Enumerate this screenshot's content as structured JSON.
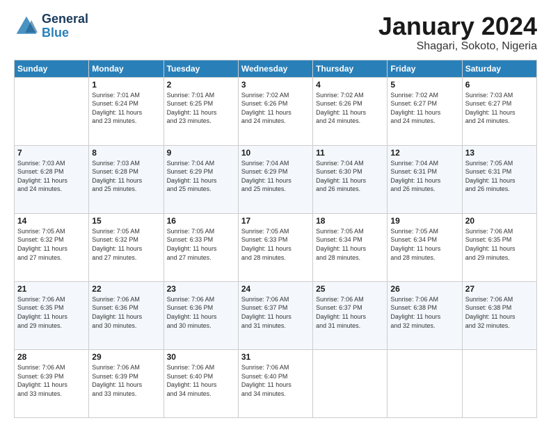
{
  "header": {
    "logo_general": "General",
    "logo_blue": "Blue",
    "month": "January 2024",
    "location": "Shagari, Sokoto, Nigeria"
  },
  "columns": [
    "Sunday",
    "Monday",
    "Tuesday",
    "Wednesday",
    "Thursday",
    "Friday",
    "Saturday"
  ],
  "weeks": [
    [
      {
        "day": "",
        "info": ""
      },
      {
        "day": "1",
        "info": "Sunrise: 7:01 AM\nSunset: 6:24 PM\nDaylight: 11 hours\nand 23 minutes."
      },
      {
        "day": "2",
        "info": "Sunrise: 7:01 AM\nSunset: 6:25 PM\nDaylight: 11 hours\nand 23 minutes."
      },
      {
        "day": "3",
        "info": "Sunrise: 7:02 AM\nSunset: 6:26 PM\nDaylight: 11 hours\nand 24 minutes."
      },
      {
        "day": "4",
        "info": "Sunrise: 7:02 AM\nSunset: 6:26 PM\nDaylight: 11 hours\nand 24 minutes."
      },
      {
        "day": "5",
        "info": "Sunrise: 7:02 AM\nSunset: 6:27 PM\nDaylight: 11 hours\nand 24 minutes."
      },
      {
        "day": "6",
        "info": "Sunrise: 7:03 AM\nSunset: 6:27 PM\nDaylight: 11 hours\nand 24 minutes."
      }
    ],
    [
      {
        "day": "7",
        "info": "Sunrise: 7:03 AM\nSunset: 6:28 PM\nDaylight: 11 hours\nand 24 minutes."
      },
      {
        "day": "8",
        "info": "Sunrise: 7:03 AM\nSunset: 6:28 PM\nDaylight: 11 hours\nand 25 minutes."
      },
      {
        "day": "9",
        "info": "Sunrise: 7:04 AM\nSunset: 6:29 PM\nDaylight: 11 hours\nand 25 minutes."
      },
      {
        "day": "10",
        "info": "Sunrise: 7:04 AM\nSunset: 6:29 PM\nDaylight: 11 hours\nand 25 minutes."
      },
      {
        "day": "11",
        "info": "Sunrise: 7:04 AM\nSunset: 6:30 PM\nDaylight: 11 hours\nand 26 minutes."
      },
      {
        "day": "12",
        "info": "Sunrise: 7:04 AM\nSunset: 6:31 PM\nDaylight: 11 hours\nand 26 minutes."
      },
      {
        "day": "13",
        "info": "Sunrise: 7:05 AM\nSunset: 6:31 PM\nDaylight: 11 hours\nand 26 minutes."
      }
    ],
    [
      {
        "day": "14",
        "info": "Sunrise: 7:05 AM\nSunset: 6:32 PM\nDaylight: 11 hours\nand 27 minutes."
      },
      {
        "day": "15",
        "info": "Sunrise: 7:05 AM\nSunset: 6:32 PM\nDaylight: 11 hours\nand 27 minutes."
      },
      {
        "day": "16",
        "info": "Sunrise: 7:05 AM\nSunset: 6:33 PM\nDaylight: 11 hours\nand 27 minutes."
      },
      {
        "day": "17",
        "info": "Sunrise: 7:05 AM\nSunset: 6:33 PM\nDaylight: 11 hours\nand 28 minutes."
      },
      {
        "day": "18",
        "info": "Sunrise: 7:05 AM\nSunset: 6:34 PM\nDaylight: 11 hours\nand 28 minutes."
      },
      {
        "day": "19",
        "info": "Sunrise: 7:05 AM\nSunset: 6:34 PM\nDaylight: 11 hours\nand 28 minutes."
      },
      {
        "day": "20",
        "info": "Sunrise: 7:06 AM\nSunset: 6:35 PM\nDaylight: 11 hours\nand 29 minutes."
      }
    ],
    [
      {
        "day": "21",
        "info": "Sunrise: 7:06 AM\nSunset: 6:35 PM\nDaylight: 11 hours\nand 29 minutes."
      },
      {
        "day": "22",
        "info": "Sunrise: 7:06 AM\nSunset: 6:36 PM\nDaylight: 11 hours\nand 30 minutes."
      },
      {
        "day": "23",
        "info": "Sunrise: 7:06 AM\nSunset: 6:36 PM\nDaylight: 11 hours\nand 30 minutes."
      },
      {
        "day": "24",
        "info": "Sunrise: 7:06 AM\nSunset: 6:37 PM\nDaylight: 11 hours\nand 31 minutes."
      },
      {
        "day": "25",
        "info": "Sunrise: 7:06 AM\nSunset: 6:37 PM\nDaylight: 11 hours\nand 31 minutes."
      },
      {
        "day": "26",
        "info": "Sunrise: 7:06 AM\nSunset: 6:38 PM\nDaylight: 11 hours\nand 32 minutes."
      },
      {
        "day": "27",
        "info": "Sunrise: 7:06 AM\nSunset: 6:38 PM\nDaylight: 11 hours\nand 32 minutes."
      }
    ],
    [
      {
        "day": "28",
        "info": "Sunrise: 7:06 AM\nSunset: 6:39 PM\nDaylight: 11 hours\nand 33 minutes."
      },
      {
        "day": "29",
        "info": "Sunrise: 7:06 AM\nSunset: 6:39 PM\nDaylight: 11 hours\nand 33 minutes."
      },
      {
        "day": "30",
        "info": "Sunrise: 7:06 AM\nSunset: 6:40 PM\nDaylight: 11 hours\nand 34 minutes."
      },
      {
        "day": "31",
        "info": "Sunrise: 7:06 AM\nSunset: 6:40 PM\nDaylight: 11 hours\nand 34 minutes."
      },
      {
        "day": "",
        "info": ""
      },
      {
        "day": "",
        "info": ""
      },
      {
        "day": "",
        "info": ""
      }
    ]
  ]
}
